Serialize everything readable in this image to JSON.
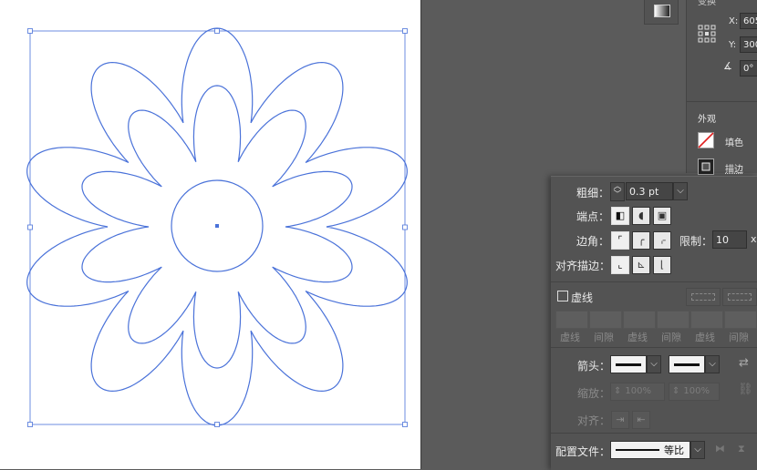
{
  "transform": {
    "title": "变换",
    "x_label": "X:",
    "x_value": "605",
    "y_label": "Y:",
    "y_value": "300",
    "angle_value": "0°"
  },
  "appearance": {
    "title": "外观",
    "fill_label": "填色",
    "stroke_label": "描边"
  },
  "stroke_panel": {
    "weight_label": "粗细：",
    "weight_value": "0.3 pt",
    "cap_label": "端点：",
    "corner_label": "边角：",
    "limit_label": "限制：",
    "limit_value": "10",
    "limit_unit": "x",
    "align_label": "对齐描边：",
    "dashed_label": "虚线",
    "dash_labels": [
      "虚线",
      "间隙",
      "虚线",
      "间隙",
      "虚线",
      "间隙"
    ],
    "arrow_label": "箭头：",
    "scale_label": "缩放：",
    "scale_start": "100%",
    "scale_end": "100%",
    "align_arrow_label": "对齐：",
    "profile_label": "配置文件：",
    "profile_value": "等比"
  },
  "colors": {
    "selection": "#4a72d9",
    "canvas": "#ffffff",
    "panel": "#535353",
    "workspace": "#5b5b5b"
  }
}
